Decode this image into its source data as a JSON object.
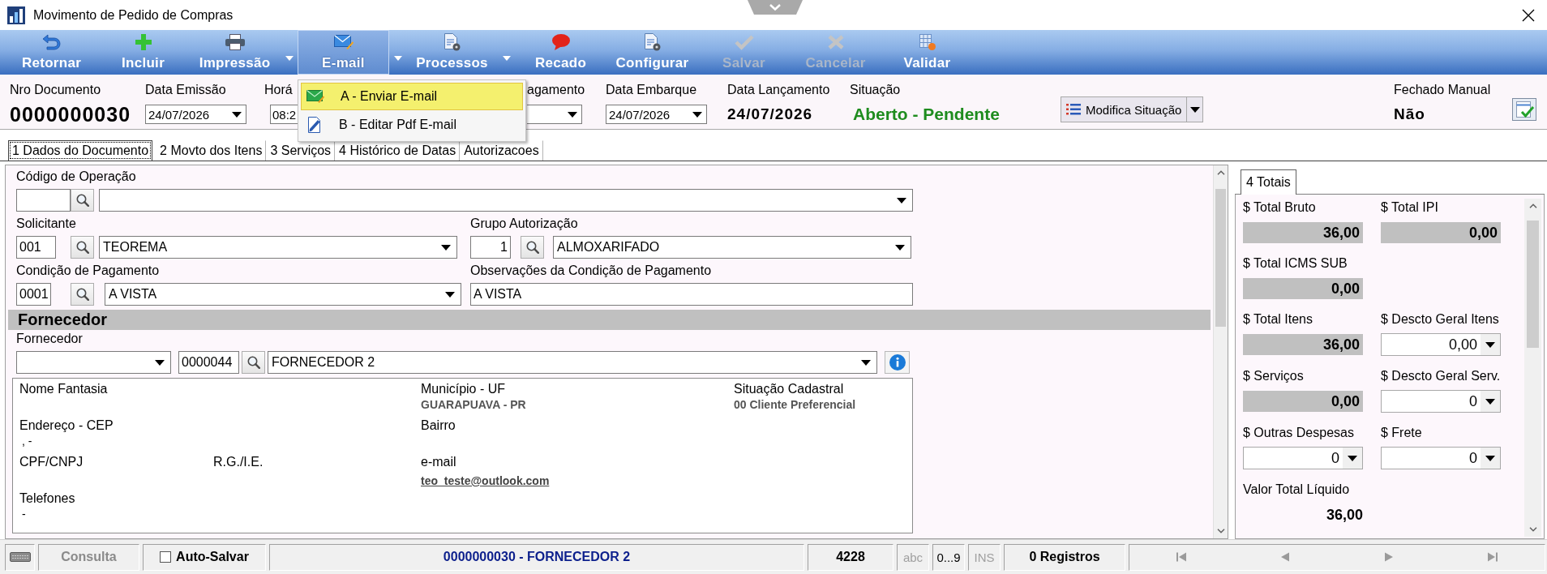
{
  "window": {
    "title": "Movimento de Pedido de Compras"
  },
  "toolbar": {
    "buttons": [
      {
        "label": "Retornar",
        "disabled": false,
        "dropdown": false,
        "expanded": false
      },
      {
        "label": "Incluir",
        "disabled": false,
        "dropdown": false,
        "expanded": false
      },
      {
        "label": "Impressão",
        "disabled": false,
        "dropdown": true,
        "expanded": false
      },
      {
        "label": "E-mail",
        "disabled": false,
        "dropdown": true,
        "expanded": true,
        "menu": [
          {
            "label": "A - Enviar E-mail",
            "selected": true
          },
          {
            "label": "B - Editar Pdf E-mail",
            "selected": false
          }
        ]
      },
      {
        "label": "Processos",
        "disabled": false,
        "dropdown": true,
        "expanded": false
      },
      {
        "label": "Recado",
        "disabled": false,
        "dropdown": false,
        "expanded": false
      },
      {
        "label": "Configurar",
        "disabled": false,
        "dropdown": false,
        "expanded": false
      },
      {
        "label": "Salvar",
        "disabled": true,
        "dropdown": false,
        "expanded": false
      },
      {
        "label": "Cancelar",
        "disabled": true,
        "dropdown": false,
        "expanded": false
      },
      {
        "label": "Validar",
        "disabled": false,
        "dropdown": false,
        "expanded": false
      }
    ]
  },
  "header": {
    "fields": [
      {
        "kind": "number",
        "label": "Nro Documento",
        "value": "0000000030"
      },
      {
        "kind": "date",
        "label": "Data Emissão",
        "value": "24/07/2026"
      },
      {
        "kind": "time",
        "label": "Horá",
        "value": "08:2"
      },
      {
        "kind": "clipped",
        "label": "agamento"
      },
      {
        "kind": "date",
        "label": "Data Embarque",
        "value": "24/07/2026"
      },
      {
        "kind": "text",
        "label": "Data Lançamento",
        "value": "24/07/2026"
      },
      {
        "kind": "status",
        "label": "Situação",
        "value": "Aberto - Pendente"
      },
      {
        "kind": "button",
        "label": "Modifica Situação"
      },
      {
        "kind": "text",
        "label": "Fechado Manual",
        "value": "Não"
      }
    ]
  },
  "tabs": [
    {
      "label": "1 Dados do Documento",
      "selected": true
    },
    {
      "label": "2 Movto dos Itens",
      "selected": false
    },
    {
      "label": "3 Serviços",
      "selected": false
    },
    {
      "label": "4 Histórico de Datas",
      "selected": false
    },
    {
      "label": "Autorizacoes",
      "selected": false
    }
  ],
  "document_form": {
    "operation": {
      "label": "Código de Operação"
    },
    "requester": {
      "label": "Solicitante",
      "code": "001",
      "name": "TEOREMA"
    },
    "authorization_group": {
      "label": "Grupo Autorização",
      "code": "1",
      "name": "ALMOXARIFADO"
    },
    "payment_condition": {
      "label": "Condição de Pagamento",
      "code": "0001",
      "name": "A VISTA"
    },
    "payment_notes": {
      "label": "Observações da Condição de Pagamento",
      "value": "A VISTA"
    },
    "supplier": {
      "section_title": "Fornecedor",
      "label": "Fornecedor",
      "code": "0000044",
      "name": "FORNECEDOR 2"
    },
    "supplier_details": {
      "trade_name": {
        "label": "Nome Fantasia"
      },
      "city_state": {
        "label": "Município - UF",
        "value": "GUARAPUAVA - PR"
      },
      "registration_status": {
        "label": "Situação Cadastral",
        "value": "00 Cliente Preferencial"
      },
      "address": {
        "label": "Endereço - CEP",
        "value": ", -"
      },
      "district": {
        "label": "Bairro"
      },
      "tax_id": {
        "label": "CPF/CNPJ"
      },
      "state_registration": {
        "label": "R.G./I.E."
      },
      "email": {
        "label": "e-mail",
        "value": "teo_teste@outlook.com"
      },
      "phones": {
        "label": "Telefones",
        "value": "-"
      }
    }
  },
  "totals": {
    "tab": {
      "label": "4 Totais",
      "selected": true
    },
    "rows": [
      [
        {
          "kind": "readonly",
          "label": "$ Total Bruto",
          "value": "36,00"
        },
        {
          "kind": "readonly",
          "label": "$ Total IPI",
          "value": "0,00"
        }
      ],
      [
        {
          "kind": "readonly",
          "label": "$ Total ICMS SUB",
          "value": "0,00"
        }
      ],
      [
        {
          "kind": "readonly",
          "label": "$ Total Itens",
          "value": "36,00"
        },
        {
          "kind": "dropdown",
          "label": "$ Descto Geral Itens",
          "value": "0,00"
        }
      ],
      [
        {
          "kind": "readonly",
          "label": "$ Serviços",
          "value": "0,00"
        },
        {
          "kind": "dropdown",
          "label": "$ Descto Geral Serv.",
          "value": "0"
        }
      ],
      [
        {
          "kind": "dropdown",
          "label": "$ Outras Despesas",
          "value": "0"
        },
        {
          "kind": "dropdown",
          "label": "$ Frete",
          "value": "0"
        }
      ],
      [
        {
          "kind": "total",
          "label": "Valor Total Líquido",
          "value": "36,00"
        }
      ]
    ]
  },
  "status_bar": {
    "mode": {
      "label": "Consulta",
      "disabled": true
    },
    "autosave": {
      "label": "Auto-Salvar",
      "checked": false
    },
    "record": "0000000030 - FORNECEDOR 2",
    "code": "4228",
    "indicators": [
      {
        "label": "abc",
        "on": false
      },
      {
        "label": "0...9",
        "on": true
      },
      {
        "label": "INS",
        "on": false
      }
    ],
    "records": "0 Registros"
  }
}
